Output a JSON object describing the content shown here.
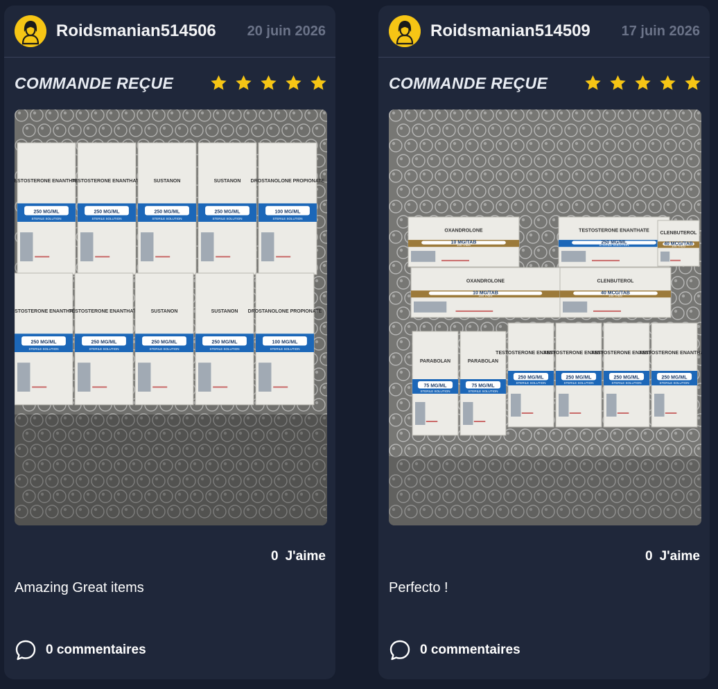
{
  "reviews": [
    {
      "username": "Roidsmanian514506",
      "date": "20 juin 2026",
      "title": "COMMANDE REÇUE",
      "rating": 5,
      "likes_count": "0",
      "likes_label": "J'aime",
      "text": "Amazing Great items",
      "comments_count": "0",
      "comments_label": "commentaires",
      "photo": {
        "description_icon": "photo-of-vials",
        "boxes": [
          {
            "row": 0,
            "name": "TESTOSTERONE ENANTHATE",
            "strength": "250 MG/ML",
            "band": "#1c67b8",
            "label": "STERILE SOLUTION"
          },
          {
            "row": 0,
            "name": "TESTOSTERONE ENANTHATE",
            "strength": "250 MG/ML",
            "band": "#1c67b8",
            "label": "STERILE SOLUTION"
          },
          {
            "row": 0,
            "name": "SUSTANON",
            "strength": "250 MG/ML",
            "band": "#1c67b8",
            "label": "STERILE SOLUTION"
          },
          {
            "row": 0,
            "name": "SUSTANON",
            "strength": "250 MG/ML",
            "band": "#1c67b8",
            "label": "STERILE SOLUTION"
          },
          {
            "row": 0,
            "name": "DROSTANOLONE PROPIONATE",
            "strength": "100 MG/ML",
            "band": "#1c67b8",
            "label": "STERILE SOLUTION"
          },
          {
            "row": 1,
            "name": "TESTOSTERONE ENANTHATE",
            "strength": "250 MG/ML",
            "band": "#1c67b8",
            "label": "STERILE SOLUTION"
          },
          {
            "row": 1,
            "name": "TESTOSTERONE ENANTHATE",
            "strength": "250 MG/ML",
            "band": "#1c67b8",
            "label": "STERILE SOLUTION"
          },
          {
            "row": 1,
            "name": "SUSTANON",
            "strength": "250 MG/ML",
            "band": "#1c67b8",
            "label": "STERILE SOLUTION"
          },
          {
            "row": 1,
            "name": "SUSTANON",
            "strength": "250 MG/ML",
            "band": "#1c67b8",
            "label": "STERILE SOLUTION"
          },
          {
            "row": 1,
            "name": "DROSTANOLONE PROPIONATE",
            "strength": "100 MG/ML",
            "band": "#1c67b8",
            "label": "STERILE SOLUTION"
          }
        ]
      }
    },
    {
      "username": "Roidsmanian514509",
      "date": "17 juin 2026",
      "title": "COMMANDE REÇUE",
      "rating": 5,
      "likes_count": "0",
      "likes_label": "J'aime",
      "text": "Perfecto !",
      "comments_count": "0",
      "comments_label": "commentaires",
      "photo": {
        "description_icon": "photo-of-vials",
        "boxes": [
          {
            "row": 0,
            "name": "OXANDROLONE",
            "strength": "10 MG/TAB",
            "band": "#9c7a3a",
            "label": "100 TABS"
          },
          {
            "row": 0,
            "name": "TESTOSTERONE ENANTHATE",
            "strength": "250 MG/ML",
            "band": "#1c67b8",
            "label": "STERILE SOLUTION"
          },
          {
            "row": 0,
            "name": "CLENBUTEROL",
            "strength": "40 MCG/TAB",
            "band": "#9c7a3a",
            "label": "100 TABS"
          },
          {
            "row": 1,
            "name": "OXANDROLONE",
            "strength": "10 MG/TAB",
            "band": "#9c7a3a",
            "label": "100 TABS"
          },
          {
            "row": 1,
            "name": "CLENBUTEROL",
            "strength": "40 MCG/TAB",
            "band": "#9c7a3a",
            "label": "100 TABS"
          },
          {
            "row": 2,
            "name": "PARABOLAN",
            "strength": "75 MG/ML",
            "band": "#1c67b8",
            "label": "STERILE SOLUTION"
          },
          {
            "row": 2,
            "name": "PARABOLAN",
            "strength": "75 MG/ML",
            "band": "#1c67b8",
            "label": "STERILE SOLUTION"
          },
          {
            "row": 2,
            "name": "TESTOSTERONE ENANTHATE",
            "strength": "250 MG/ML",
            "band": "#1c67b8",
            "label": "STERILE SOLUTION"
          },
          {
            "row": 2,
            "name": "TESTOSTERONE ENANTHATE",
            "strength": "250 MG/ML",
            "band": "#1c67b8",
            "label": "STERILE SOLUTION"
          },
          {
            "row": 2,
            "name": "TESTOSTERONE ENANTHATE",
            "strength": "250 MG/ML",
            "band": "#1c67b8",
            "label": "STERILE SOLUTION"
          },
          {
            "row": 2,
            "name": "TESTOSTERONE ENANTHATE",
            "strength": "250 MG/ML",
            "band": "#1c67b8",
            "label": "STERILE SOLUTION"
          }
        ]
      }
    }
  ],
  "colors": {
    "page_bg": "#161d2e",
    "card_bg": "#1f273a",
    "star": "#f6c515",
    "avatar_bg": "#f6c515",
    "muted_text": "#6b7388"
  }
}
